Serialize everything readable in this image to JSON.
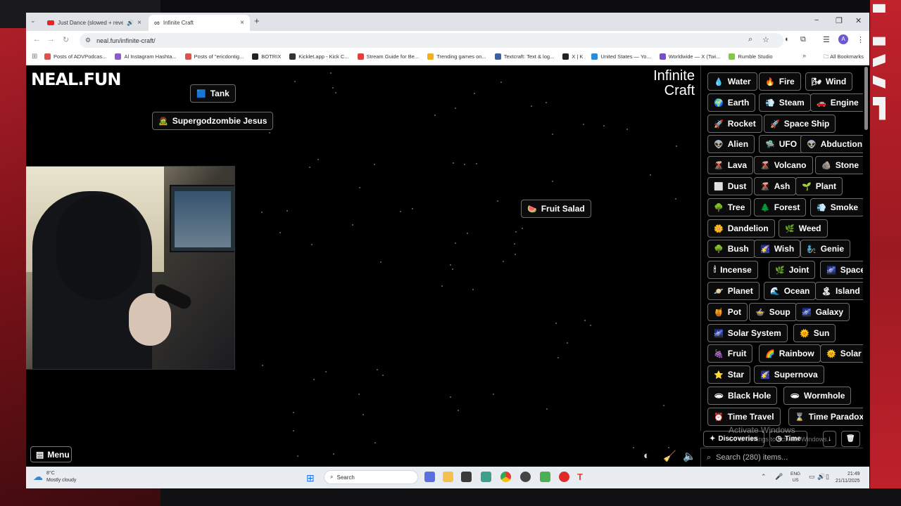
{
  "browser": {
    "tabs": [
      {
        "title": "Just Dance (slowed + reverb",
        "close": "×"
      },
      {
        "title": "Infinite Craft",
        "close": "×"
      }
    ],
    "new_tab": "+",
    "window_controls": {
      "minimize": "−",
      "maximize": "❐",
      "close": "✕"
    },
    "url": "neal.fun/infinite-craft/",
    "bookmarks": [
      {
        "label": "Posts of ADVPodcas...",
        "color": "#d9534f"
      },
      {
        "label": "Al Instagram Hashta...",
        "color": "#8e5cc9"
      },
      {
        "label": "Posts of \"ericdontig...",
        "color": "#d9534f"
      },
      {
        "label": "BOTRIX",
        "color": "#222222"
      },
      {
        "label": "Kicklet.app - Kick C...",
        "color": "#333333"
      },
      {
        "label": "Stream Guide for Be...",
        "color": "#e0413f"
      },
      {
        "label": "Trending games on...",
        "color": "#f2b01e"
      },
      {
        "label": "Textcraft: Text & log...",
        "color": "#3b5fa0"
      },
      {
        "label": "X | K",
        "color": "#222222"
      },
      {
        "label": "United States — Yo...",
        "color": "#2a8bd8"
      },
      {
        "label": "Worldwide — X (Twi...",
        "color": "#7a4dc9"
      },
      {
        "label": "Rumble Studio",
        "color": "#85c742"
      }
    ],
    "all_bookmarks": "All Bookmarks"
  },
  "game": {
    "logo": "NEAL.FUN",
    "title_line1": "Infinite",
    "title_line2": "Craft",
    "canvas_items": [
      {
        "label": "Tank",
        "icon": "🟦"
      },
      {
        "label": "Supergodzombie Jesus",
        "icon": "🧟"
      },
      {
        "label": "Fruit Salad",
        "icon": "🍉"
      }
    ],
    "menu_label": "Menu",
    "sidebar_items": [
      {
        "label": "Water",
        "icon": "💧"
      },
      {
        "label": "Fire",
        "icon": "🔥"
      },
      {
        "label": "Wind",
        "icon": "🌬"
      },
      {
        "label": "Earth",
        "icon": "🌍"
      },
      {
        "label": "Steam",
        "icon": "💨"
      },
      {
        "label": "Engine",
        "icon": "🚗"
      },
      {
        "label": "Rocket",
        "icon": "🚀"
      },
      {
        "label": "Space Ship",
        "icon": "🚀"
      },
      {
        "label": "Alien",
        "icon": "👽"
      },
      {
        "label": "UFO",
        "icon": "🛸"
      },
      {
        "label": "Abduction",
        "icon": "👽"
      },
      {
        "label": "Lava",
        "icon": "🌋"
      },
      {
        "label": "Volcano",
        "icon": "🌋"
      },
      {
        "label": "Stone",
        "icon": "🪨"
      },
      {
        "label": "Dust",
        "icon": "⬜"
      },
      {
        "label": "Ash",
        "icon": "🌋"
      },
      {
        "label": "Plant",
        "icon": "🌱"
      },
      {
        "label": "Tree",
        "icon": "🌳"
      },
      {
        "label": "Forest",
        "icon": "🌲"
      },
      {
        "label": "Smoke",
        "icon": "💨"
      },
      {
        "label": "Dandelion",
        "icon": "🌼"
      },
      {
        "label": "Weed",
        "icon": "🌿"
      },
      {
        "label": "Bush",
        "icon": "🌳"
      },
      {
        "label": "Wish",
        "icon": "🌠"
      },
      {
        "label": "Genie",
        "icon": "🧞"
      },
      {
        "label": "Incense",
        "icon": "🕯"
      },
      {
        "label": "Joint",
        "icon": "🌿"
      },
      {
        "label": "Space",
        "icon": "🌌"
      },
      {
        "label": "Planet",
        "icon": "🪐"
      },
      {
        "label": "Ocean",
        "icon": "🌊"
      },
      {
        "label": "Island",
        "icon": "🏝"
      },
      {
        "label": "Pot",
        "icon": "🍯"
      },
      {
        "label": "Soup",
        "icon": "🍲"
      },
      {
        "label": "Galaxy",
        "icon": "🌌"
      },
      {
        "label": "Solar System",
        "icon": "🌌"
      },
      {
        "label": "Sun",
        "icon": "🌞"
      },
      {
        "label": "Fruit",
        "icon": "🍇"
      },
      {
        "label": "Rainbow",
        "icon": "🌈"
      },
      {
        "label": "Solar",
        "icon": "🌞"
      },
      {
        "label": "Star",
        "icon": "⭐"
      },
      {
        "label": "Supernova",
        "icon": "🌠"
      },
      {
        "label": "Black Hole",
        "icon": "🕳"
      },
      {
        "label": "Wormhole",
        "icon": "🕳"
      },
      {
        "label": "Time Travel",
        "icon": "⏰"
      },
      {
        "label": "Time Paradox",
        "icon": "⌛"
      }
    ],
    "bottom_tabs": {
      "discoveries": "Discoveries",
      "time": "Time",
      "sort_icon": "↓",
      "trash_icon": "🗑"
    },
    "search_placeholder": "Search (280) items...",
    "watermark_title": "Activate Windows",
    "watermark_sub": "Go to Settings to activate Windows."
  },
  "taskbar": {
    "temperature": "8°C",
    "weather": "Mostly cloudy",
    "search_placeholder": "Search",
    "lang_line1": "ENG",
    "lang_line2": "US",
    "time": "21:49",
    "date": "21/11/2025"
  },
  "overlay": {
    "side_text": "LIVE"
  },
  "colors": {
    "item_border": "#6c6c6c",
    "accent_red": "#c1222c"
  }
}
